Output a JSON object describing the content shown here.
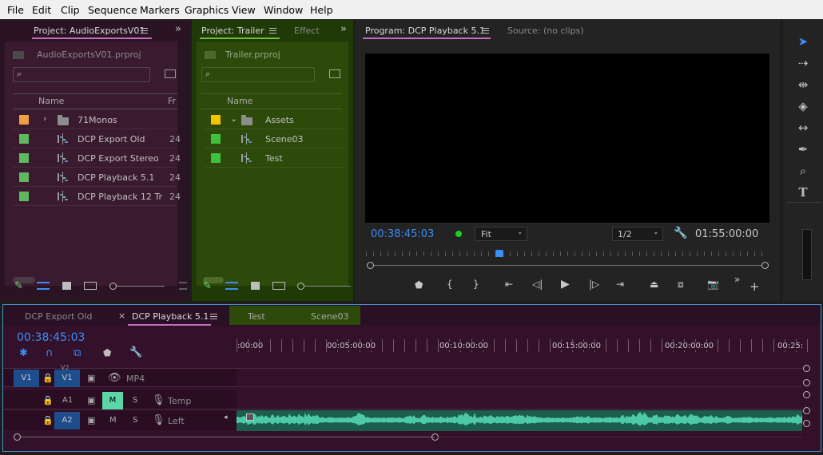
{
  "menu": [
    "File",
    "Edit",
    "Clip",
    "Sequence",
    "Markers",
    "Graphics",
    "View",
    "Window",
    "Help"
  ],
  "project1": {
    "tab_label": "Project: AudioExportsV01",
    "file_name": "AudioExportsV01.prproj",
    "col_name": "Name",
    "col_fr": "Fr",
    "items": [
      {
        "name": "71Monos",
        "type": "folder",
        "color": "#f0a040",
        "fr": ""
      },
      {
        "name": "DCP Export Old",
        "type": "sequence",
        "color": "#5fb85f",
        "fr": "24"
      },
      {
        "name": "DCP Export Stereo",
        "type": "sequence",
        "color": "#5fb85f",
        "fr": "24"
      },
      {
        "name": "DCP Playback 5.1",
        "type": "sequence",
        "color": "#5fb85f",
        "fr": "24"
      },
      {
        "name": "DCP Playback 12 Tr",
        "type": "sequence",
        "color": "#5fb85f",
        "fr": "24"
      }
    ]
  },
  "project2": {
    "tab_label": "Project: Trailer",
    "tab2_label": "Effect",
    "file_name": "Trailer.prproj",
    "col_name": "Name",
    "items": [
      {
        "name": "Assets",
        "type": "folder",
        "color": "#f5c400"
      },
      {
        "name": "Scene03",
        "type": "sequence",
        "color": "#3fc13f"
      },
      {
        "name": "Test",
        "type": "sequence",
        "color": "#3fc13f"
      }
    ]
  },
  "program": {
    "tab_label": "Program: DCP Playback 5.1",
    "source_label": "Source: (no clips)",
    "timecode": "00:38:45:03",
    "fit": "Fit",
    "resolution": "1/2",
    "duration": "01:55:00:00",
    "playhead_fraction": 0.33
  },
  "timeline": {
    "tabs": [
      "DCP Export Old",
      "DCP Playback 5.1",
      "Test",
      "Scene03"
    ],
    "timecode": "00:38:45:03",
    "ruler": [
      ":00:00",
      "00:05:00:00",
      "00:10:00:00",
      "00:15:00:00",
      "00:20:00:00",
      "00:25:"
    ],
    "v1_src": "V1",
    "v1_tgt": "V1",
    "v1_name": "MP4",
    "v2_label": "V2",
    "a1_tgt": "A1",
    "a1_name": "Temp",
    "a2_tgt": "A2",
    "a2_name": "Left",
    "m": "M",
    "s": "S",
    "waveform_color": "#4ec9a8"
  },
  "colors": {
    "project1_bg": "#3a1a2f",
    "project2_bg": "#2e4a0a",
    "timeline_bg": "#33112a",
    "accent_blue": "#3a8ef6"
  }
}
